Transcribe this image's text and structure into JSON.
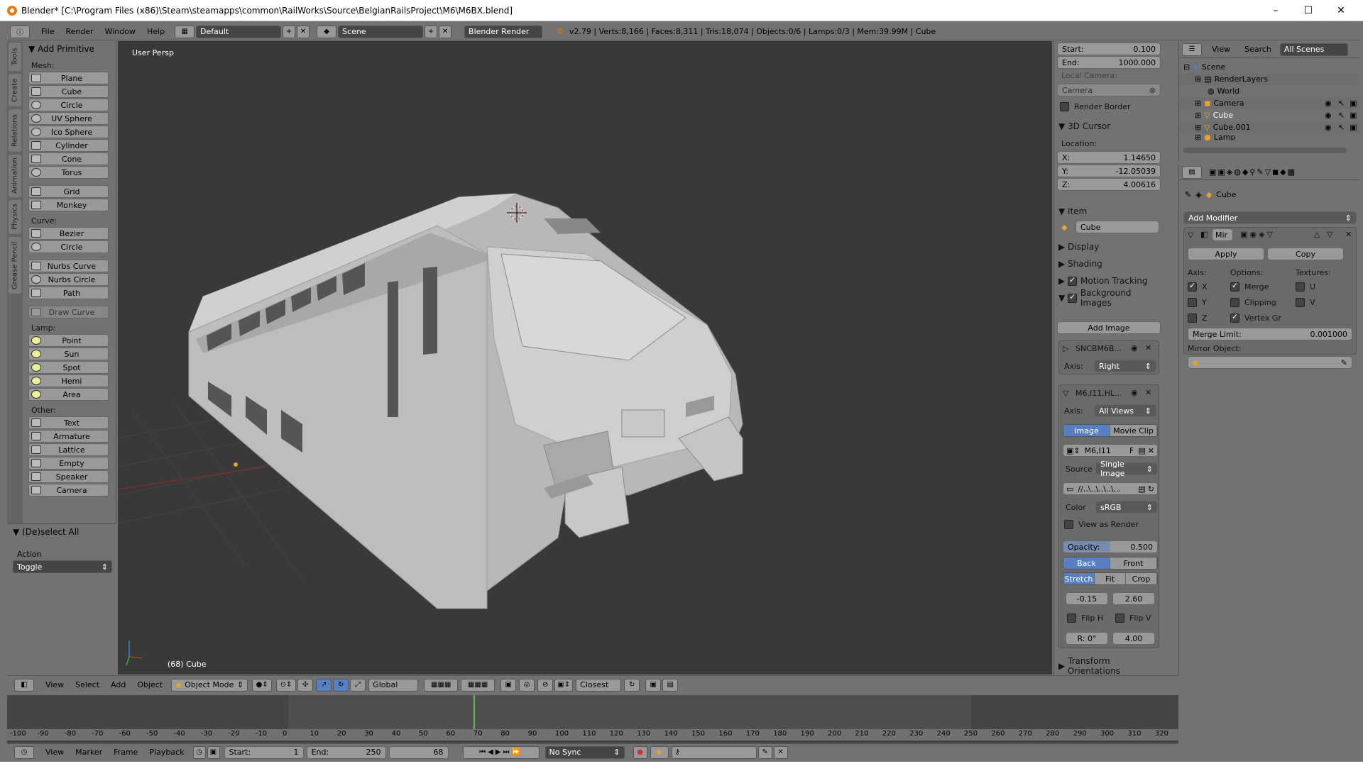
{
  "window": {
    "title": "Blender* [C:\\Program Files (x86)\\Steam\\steamapps\\common\\RailWorks\\Source\\BelgianRailsProject\\M6\\M6BX.blend]",
    "minimize": "–",
    "maximize": "☐",
    "close": "✕"
  },
  "infobar": {
    "menus": [
      "File",
      "Render",
      "Window",
      "Help"
    ],
    "layout": "Default",
    "scene": "Scene",
    "engine": "Blender Render",
    "stats": "v2.79 | Verts:8,166 | Faces:8,311 | Tris:18,074 | Objects:0/6 | Lamps:0/3 | Mem:39.99M | Cube"
  },
  "tool_tabs": [
    "Tools",
    "Create",
    "Relations",
    "Animation",
    "Physics",
    "Grease Pencil"
  ],
  "toolshelf": {
    "header": "Add Primitive",
    "mesh_label": "Mesh:",
    "mesh": [
      "Plane",
      "Cube",
      "Circle",
      "UV Sphere",
      "Ico Sphere",
      "Cylinder",
      "Cone",
      "Torus"
    ],
    "mesh2": [
      "Grid",
      "Monkey"
    ],
    "curve_label": "Curve:",
    "curve": [
      "Bezier",
      "Circle"
    ],
    "curve2": [
      "Nurbs Curve",
      "Nurbs Circle",
      "Path"
    ],
    "draw_curve": "Draw Curve",
    "lamp_label": "Lamp:",
    "lamp": [
      "Point",
      "Sun",
      "Spot",
      "Hemi",
      "Area"
    ],
    "other_label": "Other:",
    "other": [
      "Text",
      "Armature",
      "Lattice",
      "Empty",
      "Speaker",
      "Camera"
    ]
  },
  "operator": {
    "header": "(De)select All",
    "action_label": "Action",
    "action_value": "Toggle"
  },
  "viewport": {
    "label": "User Persp",
    "object": "(68) Cube"
  },
  "npanel": {
    "start_label": "Start:",
    "start": "0.100",
    "end_label": "End:",
    "end": "1000.000",
    "local_camera": "Local Camera:",
    "camera": "Camera",
    "render_border": "Render Border",
    "cursor_header": "3D Cursor",
    "location": "Location:",
    "x_label": "X:",
    "x": "1.14650",
    "y_label": "Y:",
    "y": "-12.05039",
    "z_label": "Z:",
    "z": "4.00616",
    "item_header": "Item",
    "item_name": "Cube",
    "display": "Display",
    "shading": "Shading",
    "motion_tracking": "Motion Tracking",
    "background_images": "Background Images",
    "add_image": "Add Image",
    "bg1_name": "SNCBM6B...",
    "axis_label": "Axis:",
    "bg1_axis": "Right",
    "bg2_name": "M6,I11,HL...",
    "bg2_axis": "All Views",
    "image": "Image",
    "movie_clip": "Movie Clip",
    "img_name": "M6,I11",
    "img_f": "F",
    "source_label": "Source",
    "source": "Single Image",
    "path": "//..\\..\\..\\..\\...",
    "color_label": "Color",
    "color": "sRGB",
    "view_as_render": "View as Render",
    "opacity_label": "Opacity:",
    "opacity": "0.500",
    "back": "Back",
    "front": "Front",
    "stretch": "Stretch",
    "fit": "Fit",
    "crop": "Crop",
    "off_x": "-0.15",
    "off_y": "2.60",
    "flip_h": "Flip H",
    "flip_v": "Flip V",
    "rot": "R: 0°",
    "size": "4.00",
    "transform_orientations": "Transform Orientations"
  },
  "outliner": {
    "view": "View",
    "search": "Search",
    "filter": "All Scenes",
    "rows": [
      "Scene",
      "RenderLayers",
      "World",
      "Camera",
      "Cube",
      "Cube.001",
      "Lamp"
    ]
  },
  "properties": {
    "object": "Cube",
    "add_modifier": "Add Modifier",
    "modifier_name": "Mir",
    "apply": "Apply",
    "copy": "Copy",
    "axis": "Axis:",
    "options": "Options:",
    "textures": "Textures:",
    "x": "X",
    "y": "Y",
    "z": "Z",
    "merge": "Merge",
    "clipping": "Clipping",
    "vertex_gr": "Vertex Gr",
    "u": "U",
    "v": "V",
    "merge_limit_label": "Merge Limit:",
    "merge_limit": "0.001000",
    "mirror_object": "Mirror Object:"
  },
  "view3d_header": {
    "menus": [
      "View",
      "Select",
      "Add",
      "Object"
    ],
    "mode": "Object Mode",
    "orientation": "Global",
    "snap": "Closest"
  },
  "timeline": {
    "ticks": [
      "-100",
      "-90",
      "-80",
      "-70",
      "-60",
      "-50",
      "-40",
      "-30",
      "-20",
      "-10",
      "0",
      "10",
      "20",
      "30",
      "40",
      "50",
      "60",
      "70",
      "80",
      "90",
      "100",
      "110",
      "120",
      "130",
      "140",
      "150",
      "160",
      "170",
      "180",
      "190",
      "200",
      "210",
      "220",
      "230",
      "240",
      "250",
      "260",
      "270",
      "280",
      "290",
      "300",
      "310",
      "320"
    ],
    "current_frame_value": 68,
    "menus": [
      "View",
      "Marker",
      "Frame",
      "Playback"
    ],
    "start_label": "Start:",
    "start": "1",
    "end_label": "End:",
    "end": "250",
    "frame": "68",
    "sync": "No Sync"
  },
  "colors": {
    "accent": "#5680c2",
    "viewport": "#393939",
    "panel": "#727272",
    "playhead": "#60c040",
    "cursor": "#d03030"
  }
}
